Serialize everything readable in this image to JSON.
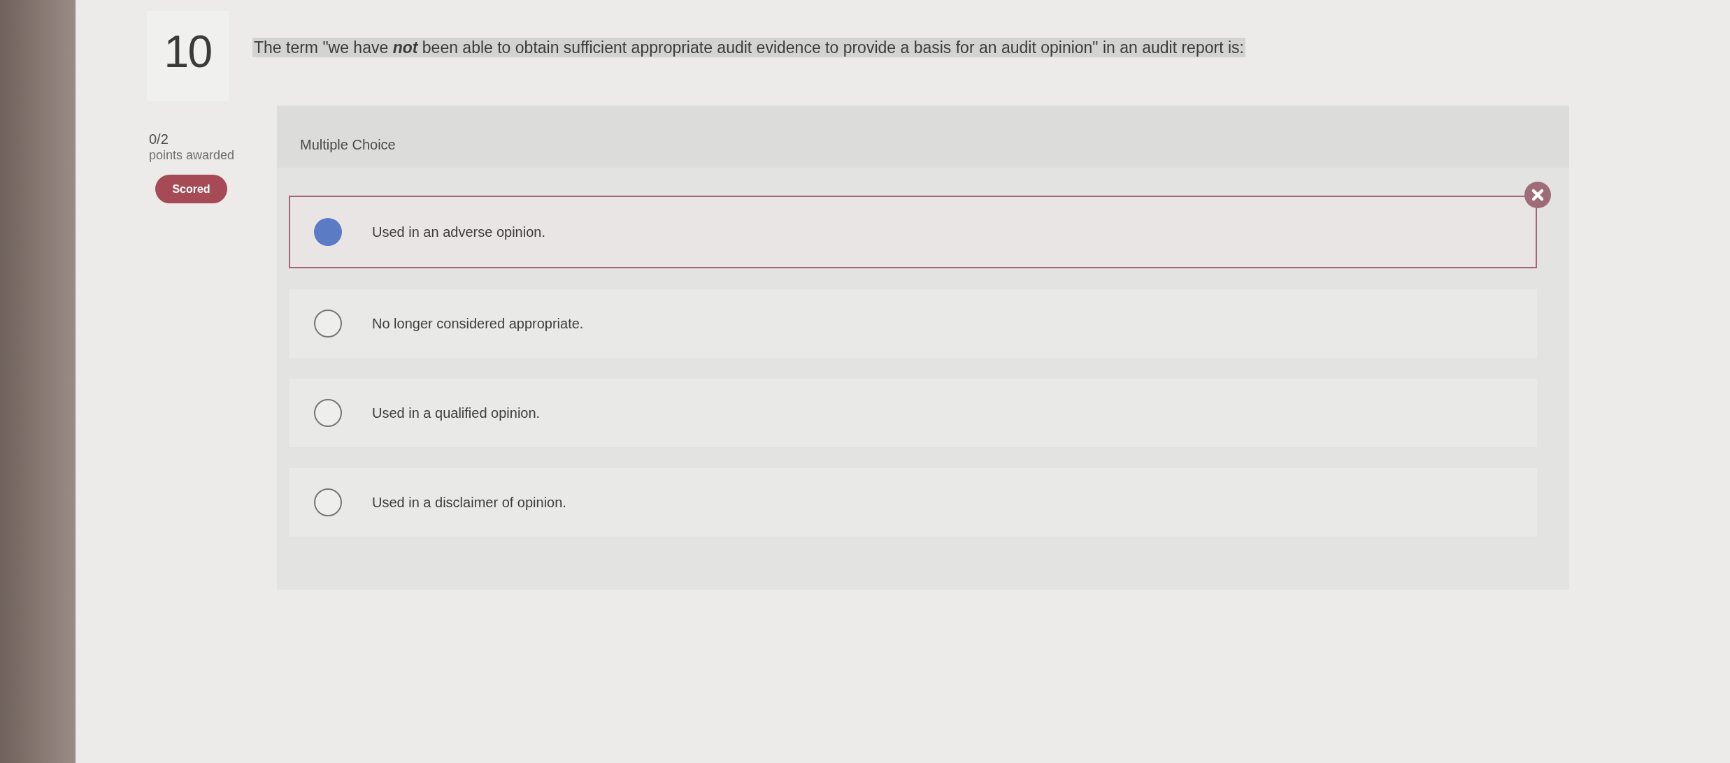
{
  "question": {
    "number": "10",
    "text": "The term \"we have **not** been able to obtain sufficient appropriate audit evidence to provide a basis for an audit opinion\" in an audit report is:",
    "highlighted": true
  },
  "score": {
    "points": "0/2",
    "label": "points awarded",
    "badge": "Scored"
  },
  "panel": {
    "type_label": "Multiple Choice"
  },
  "options": [
    {
      "text": "Used in an adverse opinion.",
      "selected": true,
      "incorrect": true
    },
    {
      "text": "No longer considered appropriate.",
      "selected": false,
      "incorrect": false
    },
    {
      "text": "Used in a qualified opinion.",
      "selected": false,
      "incorrect": false
    },
    {
      "text": "Used in a disclaimer of opinion.",
      "selected": false,
      "incorrect": false
    }
  ]
}
